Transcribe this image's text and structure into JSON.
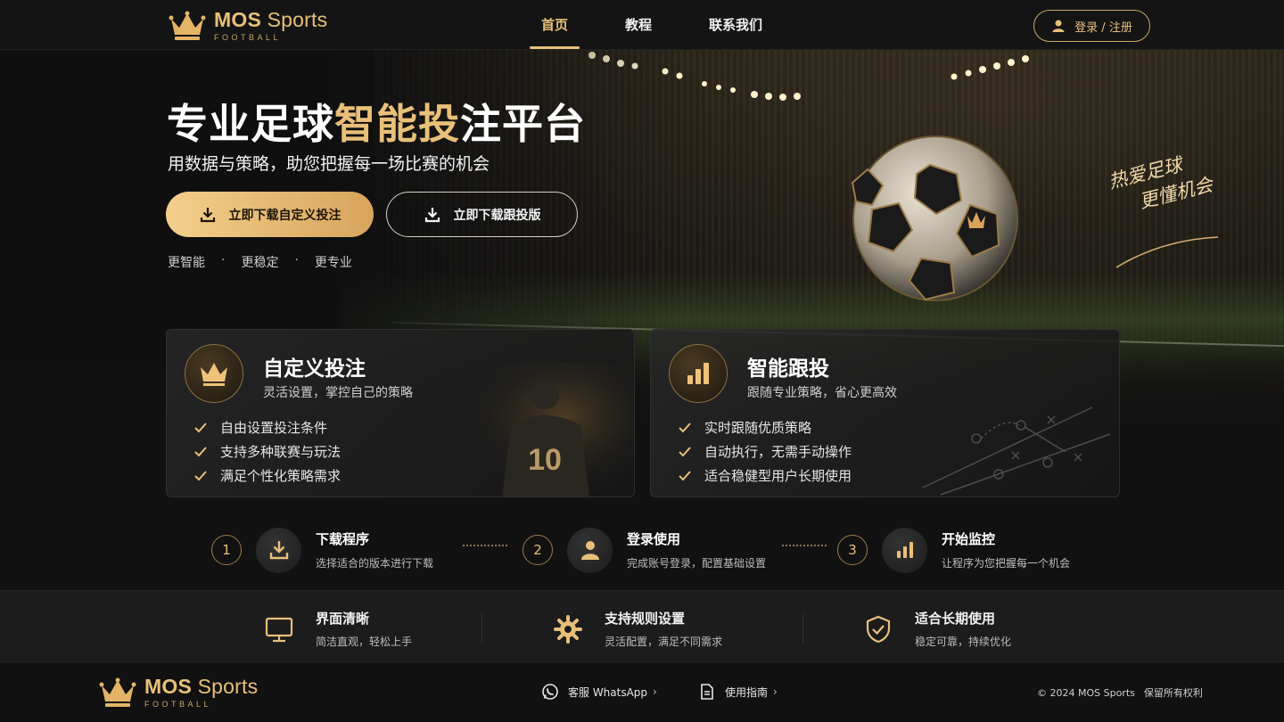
{
  "brand": {
    "name_bold": "MOS",
    "name_light": " Sports",
    "sub": "FOOTBALL"
  },
  "nav": [
    {
      "label": "首页",
      "active": true
    },
    {
      "label": "教程",
      "active": false
    },
    {
      "label": "联系我们",
      "active": false
    }
  ],
  "header": {
    "login_label": "登录 / 注册"
  },
  "hero": {
    "title_white": "专业足球",
    "title_gold": "智能投",
    "title_end": "注平台",
    "subtitle": "用数据与策略，助您把握每一场比赛的机会",
    "btn_primary": "立即下载自定义投注",
    "btn_secondary": "立即下载跟投版",
    "taglines": [
      "更智能",
      "更稳定",
      "更专业"
    ],
    "slogan": [
      "热爱足球",
      "更懂机会"
    ]
  },
  "cards": [
    {
      "title": "自定义投注",
      "desc": "灵活设置，掌控自己的策略",
      "items": [
        "自由设置投注条件",
        "支持多种联赛与玩法",
        "满足个性化策略需求"
      ],
      "jersey_number": "10"
    },
    {
      "title": "智能跟投",
      "desc": "跟随专业策略，省心更高效",
      "items": [
        "实时跟随优质策略",
        "自动执行，无需手动操作",
        "适合稳健型用户长期使用"
      ]
    }
  ],
  "steps": [
    {
      "num": "1",
      "title": "下载程序",
      "desc": "选择适合的版本进行下载",
      "icon": "download-icon"
    },
    {
      "num": "2",
      "title": "登录使用",
      "desc": "完成账号登录，配置基础设置",
      "icon": "user-icon"
    },
    {
      "num": "3",
      "title": "开始监控",
      "desc": "让程序为您把握每一个机会",
      "icon": "bar-chart-icon"
    }
  ],
  "features": [
    {
      "title": "界面清晰",
      "desc": "简洁直观，轻松上手",
      "icon": "monitor-icon"
    },
    {
      "title": "支持规则设置",
      "desc": "灵活配置，满足不同需求",
      "icon": "gear-icon"
    },
    {
      "title": "适合长期使用",
      "desc": "稳定可靠，持续优化",
      "icon": "shield-check-icon"
    }
  ],
  "footer": {
    "whatsapp": "客服 WhatsApp",
    "guide": "使用指南",
    "chevron": "›",
    "copyright": "© 2024 MOS Sports",
    "rights": "保留所有权利"
  },
  "colors": {
    "gold": "#e8c079",
    "background": "#0f0f10",
    "panel": "#1c1c1d"
  }
}
